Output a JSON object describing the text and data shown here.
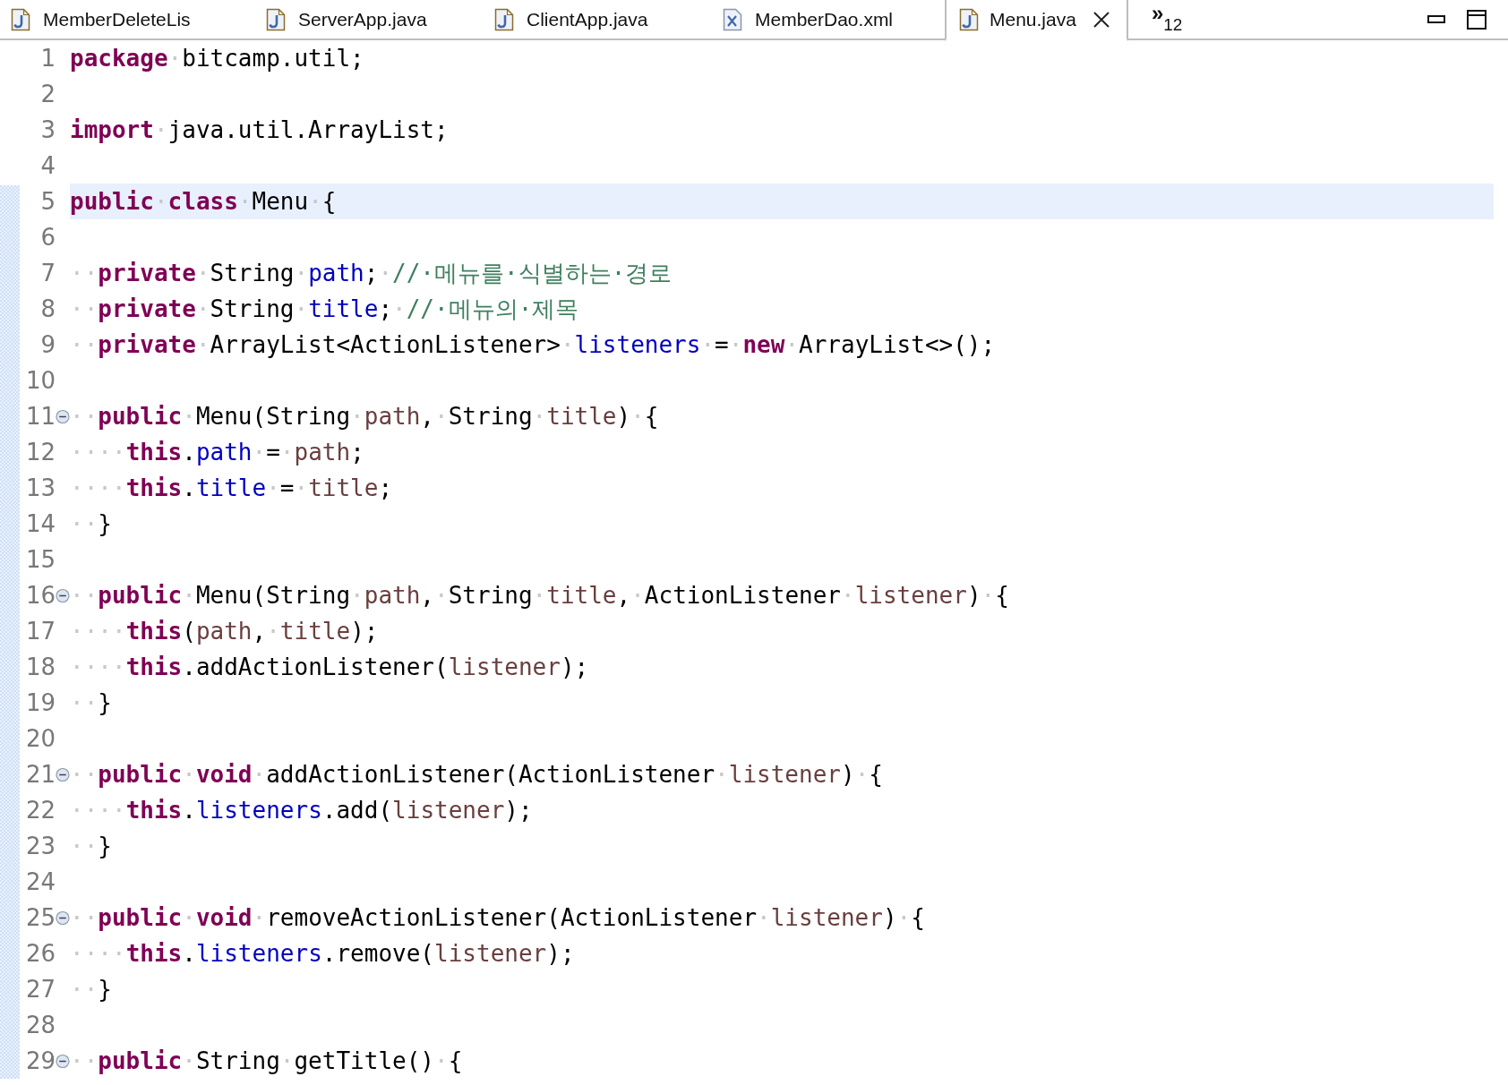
{
  "tabs": [
    {
      "label": "MemberDeleteLis",
      "kind": "java",
      "selected": false,
      "closable": false
    },
    {
      "label": "ServerApp.java",
      "kind": "java",
      "selected": false,
      "closable": false
    },
    {
      "label": "ClientApp.java",
      "kind": "java",
      "selected": false,
      "closable": false
    },
    {
      "label": "MemberDao.xml",
      "kind": "xml",
      "selected": false,
      "closable": false
    },
    {
      "label": "Menu.java",
      "kind": "java",
      "selected": true,
      "closable": true
    }
  ],
  "overflow": {
    "marker": "»",
    "count": "12"
  },
  "lines": [
    {
      "number": "1",
      "fold": false,
      "current": false,
      "tokens": [
        {
          "kind": "keyword",
          "text": "package"
        },
        {
          "kind": "ws",
          "text": "·"
        },
        {
          "kind": "plain",
          "text": "bitcamp.util;"
        }
      ]
    },
    {
      "number": "2",
      "fold": false,
      "current": false
    },
    {
      "number": "3",
      "fold": false,
      "current": false,
      "tokens": [
        {
          "kind": "keyword",
          "text": "import"
        },
        {
          "kind": "ws",
          "text": "·"
        },
        {
          "kind": "plain",
          "text": "java.util.ArrayList;"
        }
      ]
    },
    {
      "number": "4",
      "fold": false,
      "current": false
    },
    {
      "number": "5",
      "fold": false,
      "current": true,
      "tokens": [
        {
          "kind": "keyword",
          "text": "public"
        },
        {
          "kind": "ws",
          "text": "·"
        },
        {
          "kind": "keyword",
          "text": "class"
        },
        {
          "kind": "ws",
          "text": "·"
        },
        {
          "kind": "plain",
          "text": "Menu"
        },
        {
          "kind": "ws",
          "text": "·"
        },
        {
          "kind": "plain",
          "text": "{"
        }
      ]
    },
    {
      "number": "6",
      "fold": false,
      "current": false
    },
    {
      "number": "7",
      "fold": false,
      "current": false,
      "tokens": [
        {
          "kind": "ws",
          "text": "··"
        },
        {
          "kind": "keyword",
          "text": "private"
        },
        {
          "kind": "ws",
          "text": "·"
        },
        {
          "kind": "plain",
          "text": "String"
        },
        {
          "kind": "ws",
          "text": "·"
        },
        {
          "kind": "field",
          "text": "path"
        },
        {
          "kind": "plain",
          "text": ";"
        },
        {
          "kind": "ws",
          "text": "·"
        },
        {
          "kind": "comment",
          "text": "//·메뉴를·식별하는·경로"
        }
      ]
    },
    {
      "number": "8",
      "fold": false,
      "current": false,
      "tokens": [
        {
          "kind": "ws",
          "text": "··"
        },
        {
          "kind": "keyword",
          "text": "private"
        },
        {
          "kind": "ws",
          "text": "·"
        },
        {
          "kind": "plain",
          "text": "String"
        },
        {
          "kind": "ws",
          "text": "·"
        },
        {
          "kind": "field",
          "text": "title"
        },
        {
          "kind": "plain",
          "text": ";"
        },
        {
          "kind": "ws",
          "text": "·"
        },
        {
          "kind": "comment",
          "text": "//·메뉴의·제목"
        }
      ]
    },
    {
      "number": "9",
      "fold": false,
      "current": false,
      "tokens": [
        {
          "kind": "ws",
          "text": "··"
        },
        {
          "kind": "keyword",
          "text": "private"
        },
        {
          "kind": "ws",
          "text": "·"
        },
        {
          "kind": "plain",
          "text": "ArrayList<ActionListener>"
        },
        {
          "kind": "ws",
          "text": "·"
        },
        {
          "kind": "field",
          "text": "listeners"
        },
        {
          "kind": "ws",
          "text": "·"
        },
        {
          "kind": "plain",
          "text": "="
        },
        {
          "kind": "ws",
          "text": "·"
        },
        {
          "kind": "keyword",
          "text": "new"
        },
        {
          "kind": "ws",
          "text": "·"
        },
        {
          "kind": "plain",
          "text": "ArrayList<>();"
        }
      ]
    },
    {
      "number": "10",
      "fold": false,
      "current": false
    },
    {
      "number": "11",
      "fold": true,
      "current": false,
      "tokens": [
        {
          "kind": "ws",
          "text": "··"
        },
        {
          "kind": "keyword",
          "text": "public"
        },
        {
          "kind": "ws",
          "text": "·"
        },
        {
          "kind": "plain",
          "text": "Menu(String"
        },
        {
          "kind": "ws",
          "text": "·"
        },
        {
          "kind": "param",
          "text": "path"
        },
        {
          "kind": "plain",
          "text": ","
        },
        {
          "kind": "ws",
          "text": "·"
        },
        {
          "kind": "plain",
          "text": "String"
        },
        {
          "kind": "ws",
          "text": "·"
        },
        {
          "kind": "param",
          "text": "title"
        },
        {
          "kind": "plain",
          "text": ")"
        },
        {
          "kind": "ws",
          "text": "·"
        },
        {
          "kind": "plain",
          "text": "{"
        }
      ]
    },
    {
      "number": "12",
      "fold": false,
      "current": false,
      "tokens": [
        {
          "kind": "ws",
          "text": "····"
        },
        {
          "kind": "keyword",
          "text": "this"
        },
        {
          "kind": "plain",
          "text": "."
        },
        {
          "kind": "field",
          "text": "path"
        },
        {
          "kind": "ws",
          "text": "·"
        },
        {
          "kind": "plain",
          "text": "="
        },
        {
          "kind": "ws",
          "text": "·"
        },
        {
          "kind": "param",
          "text": "path"
        },
        {
          "kind": "plain",
          "text": ";"
        }
      ]
    },
    {
      "number": "13",
      "fold": false,
      "current": false,
      "tokens": [
        {
          "kind": "ws",
          "text": "····"
        },
        {
          "kind": "keyword",
          "text": "this"
        },
        {
          "kind": "plain",
          "text": "."
        },
        {
          "kind": "field",
          "text": "title"
        },
        {
          "kind": "ws",
          "text": "·"
        },
        {
          "kind": "plain",
          "text": "="
        },
        {
          "kind": "ws",
          "text": "·"
        },
        {
          "kind": "param",
          "text": "title"
        },
        {
          "kind": "plain",
          "text": ";"
        }
      ]
    },
    {
      "number": "14",
      "fold": false,
      "current": false,
      "tokens": [
        {
          "kind": "ws",
          "text": "··"
        },
        {
          "kind": "plain",
          "text": "}"
        }
      ]
    },
    {
      "number": "15",
      "fold": false,
      "current": false
    },
    {
      "number": "16",
      "fold": true,
      "current": false,
      "tokens": [
        {
          "kind": "ws",
          "text": "··"
        },
        {
          "kind": "keyword",
          "text": "public"
        },
        {
          "kind": "ws",
          "text": "·"
        },
        {
          "kind": "plain",
          "text": "Menu(String"
        },
        {
          "kind": "ws",
          "text": "·"
        },
        {
          "kind": "param",
          "text": "path"
        },
        {
          "kind": "plain",
          "text": ","
        },
        {
          "kind": "ws",
          "text": "·"
        },
        {
          "kind": "plain",
          "text": "String"
        },
        {
          "kind": "ws",
          "text": "·"
        },
        {
          "kind": "param",
          "text": "title"
        },
        {
          "kind": "plain",
          "text": ","
        },
        {
          "kind": "ws",
          "text": "·"
        },
        {
          "kind": "plain",
          "text": "ActionListener"
        },
        {
          "kind": "ws",
          "text": "·"
        },
        {
          "kind": "param",
          "text": "listener"
        },
        {
          "kind": "plain",
          "text": ")"
        },
        {
          "kind": "ws",
          "text": "·"
        },
        {
          "kind": "plain",
          "text": "{"
        }
      ]
    },
    {
      "number": "17",
      "fold": false,
      "current": false,
      "tokens": [
        {
          "kind": "ws",
          "text": "····"
        },
        {
          "kind": "keyword",
          "text": "this"
        },
        {
          "kind": "plain",
          "text": "("
        },
        {
          "kind": "param",
          "text": "path"
        },
        {
          "kind": "plain",
          "text": ","
        },
        {
          "kind": "ws",
          "text": "·"
        },
        {
          "kind": "param",
          "text": "title"
        },
        {
          "kind": "plain",
          "text": ");"
        }
      ]
    },
    {
      "number": "18",
      "fold": false,
      "current": false,
      "tokens": [
        {
          "kind": "ws",
          "text": "····"
        },
        {
          "kind": "keyword",
          "text": "this"
        },
        {
          "kind": "plain",
          "text": ".addActionListener("
        },
        {
          "kind": "param",
          "text": "listener"
        },
        {
          "kind": "plain",
          "text": ");"
        }
      ]
    },
    {
      "number": "19",
      "fold": false,
      "current": false,
      "tokens": [
        {
          "kind": "ws",
          "text": "··"
        },
        {
          "kind": "plain",
          "text": "}"
        }
      ]
    },
    {
      "number": "20",
      "fold": false,
      "current": false
    },
    {
      "number": "21",
      "fold": true,
      "current": false,
      "tokens": [
        {
          "kind": "ws",
          "text": "··"
        },
        {
          "kind": "keyword",
          "text": "public"
        },
        {
          "kind": "ws",
          "text": "·"
        },
        {
          "kind": "keyword",
          "text": "void"
        },
        {
          "kind": "ws",
          "text": "·"
        },
        {
          "kind": "plain",
          "text": "addActionListener(ActionListener"
        },
        {
          "kind": "ws",
          "text": "·"
        },
        {
          "kind": "param",
          "text": "listener"
        },
        {
          "kind": "plain",
          "text": ")"
        },
        {
          "kind": "ws",
          "text": "·"
        },
        {
          "kind": "plain",
          "text": "{"
        }
      ]
    },
    {
      "number": "22",
      "fold": false,
      "current": false,
      "tokens": [
        {
          "kind": "ws",
          "text": "····"
        },
        {
          "kind": "keyword",
          "text": "this"
        },
        {
          "kind": "plain",
          "text": "."
        },
        {
          "kind": "field",
          "text": "listeners"
        },
        {
          "kind": "plain",
          "text": ".add("
        },
        {
          "kind": "param",
          "text": "listener"
        },
        {
          "kind": "plain",
          "text": ");"
        }
      ]
    },
    {
      "number": "23",
      "fold": false,
      "current": false,
      "tokens": [
        {
          "kind": "ws",
          "text": "··"
        },
        {
          "kind": "plain",
          "text": "}"
        }
      ]
    },
    {
      "number": "24",
      "fold": false,
      "current": false
    },
    {
      "number": "25",
      "fold": true,
      "current": false,
      "tokens": [
        {
          "kind": "ws",
          "text": "··"
        },
        {
          "kind": "keyword",
          "text": "public"
        },
        {
          "kind": "ws",
          "text": "·"
        },
        {
          "kind": "keyword",
          "text": "void"
        },
        {
          "kind": "ws",
          "text": "·"
        },
        {
          "kind": "plain",
          "text": "removeActionListener(ActionListener"
        },
        {
          "kind": "ws",
          "text": "·"
        },
        {
          "kind": "param",
          "text": "listener"
        },
        {
          "kind": "plain",
          "text": ")"
        },
        {
          "kind": "ws",
          "text": "·"
        },
        {
          "kind": "plain",
          "text": "{"
        }
      ]
    },
    {
      "number": "26",
      "fold": false,
      "current": false,
      "tokens": [
        {
          "kind": "ws",
          "text": "····"
        },
        {
          "kind": "keyword",
          "text": "this"
        },
        {
          "kind": "plain",
          "text": "."
        },
        {
          "kind": "field",
          "text": "listeners"
        },
        {
          "kind": "plain",
          "text": ".remove("
        },
        {
          "kind": "param",
          "text": "listener"
        },
        {
          "kind": "plain",
          "text": ");"
        }
      ]
    },
    {
      "number": "27",
      "fold": false,
      "current": false,
      "tokens": [
        {
          "kind": "ws",
          "text": "··"
        },
        {
          "kind": "plain",
          "text": "}"
        }
      ]
    },
    {
      "number": "28",
      "fold": false,
      "current": false
    },
    {
      "number": "29",
      "fold": true,
      "current": false,
      "tokens": [
        {
          "kind": "ws",
          "text": "··"
        },
        {
          "kind": "keyword",
          "text": "public"
        },
        {
          "kind": "ws",
          "text": "·"
        },
        {
          "kind": "plain",
          "text": "String"
        },
        {
          "kind": "ws",
          "text": "·"
        },
        {
          "kind": "plain",
          "text": "getTitle()"
        },
        {
          "kind": "ws",
          "text": "·"
        },
        {
          "kind": "plain",
          "text": "{"
        }
      ]
    }
  ]
}
